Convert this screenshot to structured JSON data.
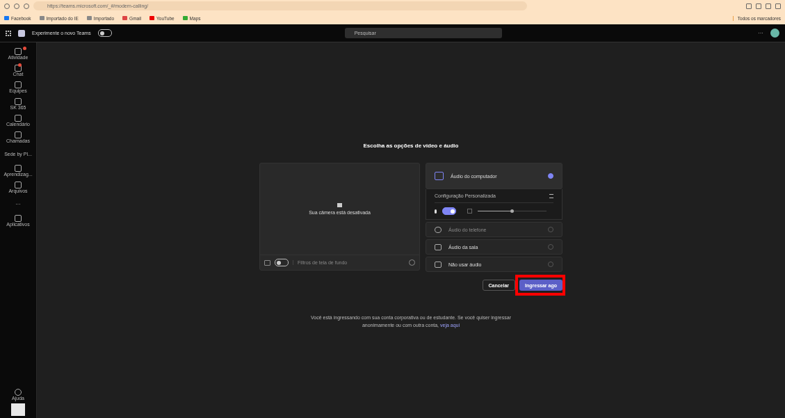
{
  "browser": {
    "url": "https://teams.microsoft.com/_#/modern-calling/",
    "bookmarks": [
      {
        "label": "Facebook",
        "kind": "facebook"
      },
      {
        "label": "Importado do IE",
        "kind": "folder"
      },
      {
        "label": "Importado",
        "kind": "folder"
      },
      {
        "label": "Gmail",
        "kind": "gmail"
      },
      {
        "label": "YouTube",
        "kind": "youtube"
      },
      {
        "label": "Maps",
        "kind": "maps"
      }
    ],
    "all_bookmarks": "Todos os marcadores"
  },
  "teams_bar": {
    "new_teams_label": "Experimente o novo Teams",
    "new_teams_on": false,
    "search_placeholder": "Pesquisar",
    "more": "···"
  },
  "sidebar": {
    "items": [
      {
        "label": "Atividade",
        "kind": "bell",
        "badge": true
      },
      {
        "label": "Chat",
        "kind": "chat",
        "badge": true
      },
      {
        "label": "Equipes",
        "kind": "teams",
        "badge": false
      },
      {
        "label": "SK 365",
        "kind": "bag",
        "badge": false
      },
      {
        "label": "Calendário",
        "kind": "calendar",
        "badge": false
      },
      {
        "label": "Chamadas",
        "kind": "phone",
        "badge": false
      },
      {
        "label": "Sede by Pl...",
        "kind": "none",
        "badge": false
      },
      {
        "label": "Aprendizag...",
        "kind": "book",
        "badge": false
      },
      {
        "label": "Arquivos",
        "kind": "file",
        "badge": false
      },
      {
        "label": "···",
        "kind": "more",
        "badge": false
      },
      {
        "label": "Aplicativos",
        "kind": "apps",
        "badge": false
      }
    ],
    "help": "Ajuda"
  },
  "heading": "Escolha as opções de vídeo e áudio",
  "camera": {
    "message": "Sua câmera está desativada",
    "camera_on": false,
    "filters_label": "Filtros de tela de fundo"
  },
  "audio_options": [
    {
      "label": "Áudio do computador",
      "kind": "computer",
      "selected": true,
      "disabled": false
    },
    {
      "label": "Áudio do telefone",
      "kind": "phone",
      "selected": false,
      "disabled": true
    },
    {
      "label": "Áudio da sala",
      "kind": "room",
      "selected": false,
      "disabled": false
    },
    {
      "label": "Não usar áudio",
      "kind": "noaudio",
      "selected": false,
      "disabled": false
    }
  ],
  "custom_config": {
    "label": "Configuração Personalizada",
    "mic_on": true,
    "volume": {
      "level": 0.5
    }
  },
  "buttons": {
    "cancel": "Cancelar",
    "join": "Ingressar ago"
  },
  "notice": {
    "text": "Você está ingressando com sua conta corporativa ou de estudante. Se você quiser ingressar anonimamente ou com outra conta,",
    "link": "veja aqui"
  }
}
